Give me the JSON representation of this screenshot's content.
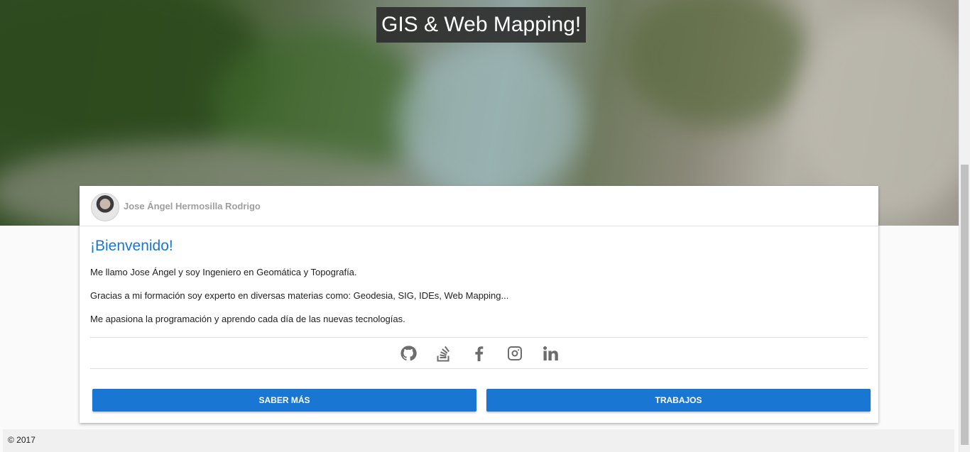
{
  "hero": {
    "title": "GIS & Web Mapping!"
  },
  "card": {
    "author": "Jose Ángel Hermosilla Rodrigo",
    "welcome": "¡Bienvenido!",
    "paragraphs": [
      "Me llamo Jose Ángel y soy Ingeniero en Geomática y Topografía.",
      "Gracias a mi formación soy experto en diversas materias como: Geodesia, SIG, IDEs, Web Mapping...",
      "Me apasiona la programación y aprendo cada día de las nuevas tecnologías."
    ],
    "social_icons": [
      "github-icon",
      "stackoverflow-icon",
      "facebook-icon",
      "instagram-icon",
      "linkedin-icon"
    ],
    "buttons": {
      "more": "SABER MÁS",
      "works": "TRABAJOS"
    }
  },
  "footer": {
    "copyright": "© 2017"
  },
  "colors": {
    "primary": "#1976d2",
    "icon": "#6d6d6d"
  }
}
